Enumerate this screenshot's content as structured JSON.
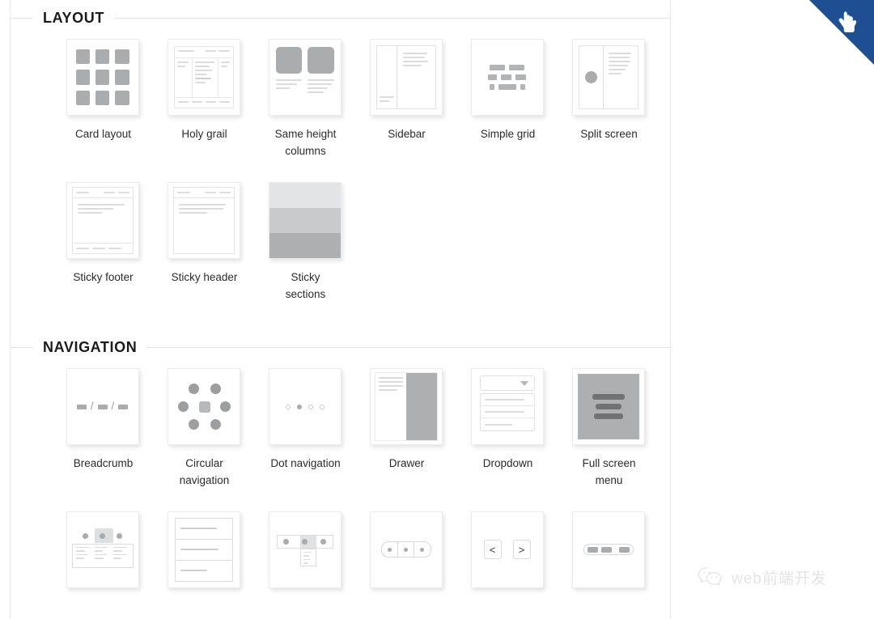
{
  "page": {
    "background_color": "#ffffff",
    "panel_border_color": "#e8e8e8"
  },
  "ribbon": {
    "color": "#1e4f93",
    "icon": "pointing-hand-icon"
  },
  "watermark": {
    "icon": "wechat-icon",
    "text": "web前端开发",
    "color": "#c9c9c9"
  },
  "sections": [
    {
      "id": "layout",
      "title": "LAYOUT",
      "items": [
        {
          "label": "Card layout",
          "art": "cards"
        },
        {
          "label": "Holy grail",
          "art": "holy-grail"
        },
        {
          "label": "Same height\ncolumns",
          "art": "same-height-columns"
        },
        {
          "label": "Sidebar",
          "art": "sidebar"
        },
        {
          "label": "Simple grid",
          "art": "simple-grid"
        },
        {
          "label": "Split screen",
          "art": "split-screen"
        },
        {
          "label": "Sticky footer",
          "art": "sticky-footer"
        },
        {
          "label": "Sticky header",
          "art": "sticky-header"
        },
        {
          "label": "Sticky\nsections",
          "art": "sticky-sections"
        }
      ]
    },
    {
      "id": "navigation",
      "title": "NAVIGATION",
      "items": [
        {
          "label": "Breadcrumb",
          "art": "breadcrumb"
        },
        {
          "label": "Circular\nnavigation",
          "art": "circular-navigation"
        },
        {
          "label": "Dot navigation",
          "art": "dot-navigation"
        },
        {
          "label": "Drawer",
          "art": "drawer"
        },
        {
          "label": "Dropdown",
          "art": "dropdown"
        },
        {
          "label": "Full screen\nmenu",
          "art": "full-screen-menu"
        },
        {
          "label": "",
          "art": "mega-menu"
        },
        {
          "label": "",
          "art": "list-menu"
        },
        {
          "label": "",
          "art": "nav-with-dropdown"
        },
        {
          "label": "",
          "art": "pill-navigation"
        },
        {
          "label": "",
          "art": "prev-next"
        },
        {
          "label": "",
          "art": "segmented-tabs"
        }
      ]
    }
  ],
  "nav_row3_glyphs": {
    "prev": "<",
    "next": ">"
  }
}
